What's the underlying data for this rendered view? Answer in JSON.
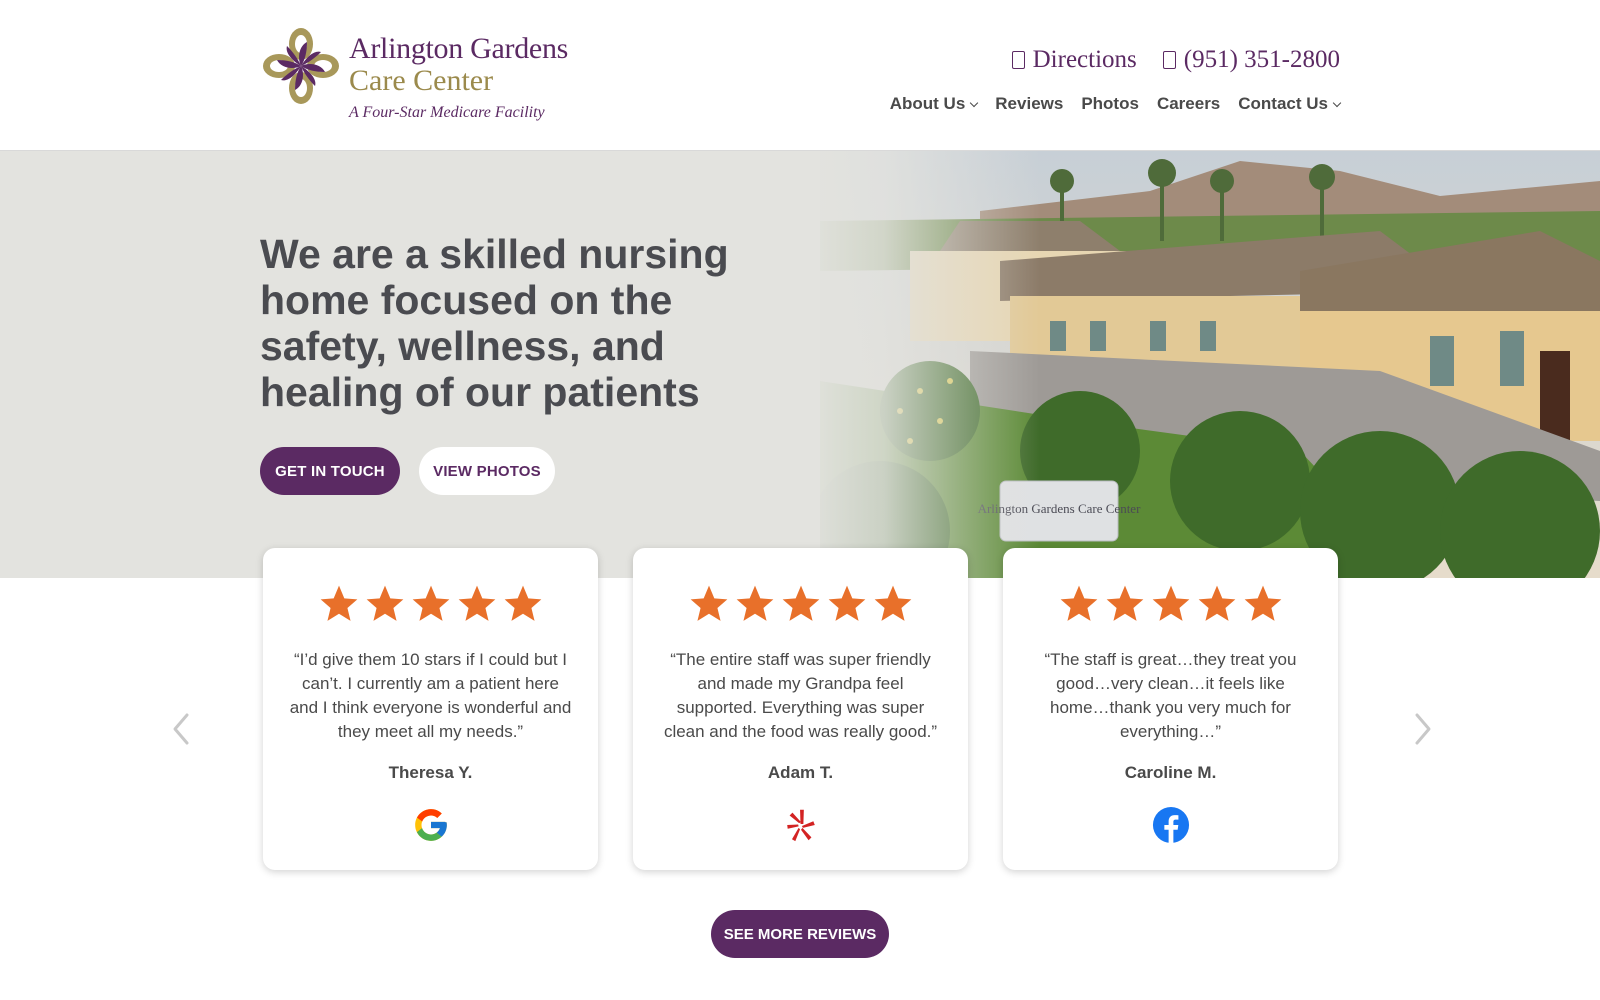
{
  "header": {
    "logo": {
      "line1": "Arlington Gardens",
      "line2": "Care Center",
      "tagline": "A Four-Star Medicare Facility"
    },
    "contacts": {
      "directions": "Directions",
      "phone": "(951) 351-2800"
    },
    "nav": [
      {
        "label": "About Us",
        "has_dropdown": true
      },
      {
        "label": "Reviews",
        "has_dropdown": false
      },
      {
        "label": "Photos",
        "has_dropdown": false
      },
      {
        "label": "Careers",
        "has_dropdown": false
      },
      {
        "label": "Contact Us",
        "has_dropdown": true
      }
    ]
  },
  "hero": {
    "title": "We are a skilled nursing home focused on the safety, wellness, and healing of our patients",
    "primary_button": "GET IN TOUCH",
    "secondary_button": "VIEW PHOTOS",
    "photo_sign_text": "Arlington Gardens Care Center"
  },
  "reviews": [
    {
      "stars": 5,
      "quote": "“I’d give them 10 stars if I could but I can’t. I currently am a patient here and I think everyone is wonderful and they meet all my needs.”",
      "name": "Theresa Y.",
      "platform": "google-icon"
    },
    {
      "stars": 5,
      "quote": "“The entire staff was super friendly and made my Grandpa feel supported. Everything was super clean and the food was really good.”",
      "name": "Adam T.",
      "platform": "yelp-icon"
    },
    {
      "stars": 5,
      "quote": "“The staff is great…they treat you good…very clean…it feels like home…thank you very much for everything…”",
      "name": "Caroline M.",
      "platform": "facebook-icon"
    }
  ],
  "carousel": {
    "prev_icon": "chevron-left-icon",
    "next_icon": "chevron-right-icon"
  },
  "see_more": "SEE MORE REVIEWS",
  "colors": {
    "brand_purple": "#5b2a63",
    "brand_gold": "#9b8a4c",
    "hero_bg": "#e3e3df",
    "star_orange": "#e8702a"
  }
}
